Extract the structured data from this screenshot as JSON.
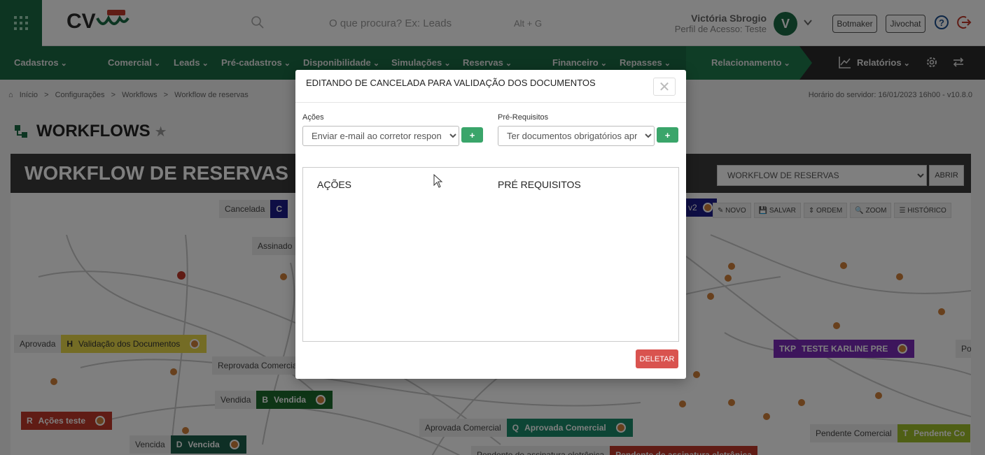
{
  "header": {
    "search_placeholder": "O que procura? Ex: Leads",
    "shortcut": "Alt + G",
    "user_name": "Victória Sbrogio",
    "user_profile": "Perfil de Acesso: Teste",
    "avatar_letter": "V",
    "buttons": [
      "Botmaker",
      "Jivochat"
    ],
    "help": "?"
  },
  "nav": {
    "items": [
      "Cadastros",
      "Comercial",
      "Leads",
      "Pré-cadastros",
      "Disponibilidade",
      "Simulações",
      "Reservas",
      "Financeiro",
      "Repasses",
      "Relacionamento",
      "Relatórios"
    ]
  },
  "breadcrumb": {
    "items": [
      "Início",
      ">",
      "Configurações",
      ">",
      "Workflows",
      ">",
      "Workflow de reservas"
    ]
  },
  "server_time": "Horário do servidor: 16/01/2023 16h00 - v10.8.0",
  "page": {
    "title": "WORKFLOWS",
    "star": "★"
  },
  "workflow": {
    "title": "WORKFLOW DE RESERVAS",
    "select_value": "WORKFLOW DE RESERVAS",
    "open_button": "ABRIR",
    "toolbar": [
      "NOVO",
      "SALVAR",
      "ORDEM",
      "ZOOM",
      "HISTÓRICO"
    ],
    "nodes": [
      {
        "label": "Cancelada",
        "code": "C",
        "name": ""
      },
      {
        "label": "Assinado",
        "code": "",
        "name": ""
      },
      {
        "label": "Aprovada",
        "code": "H",
        "name": "Validação dos Documentos"
      },
      {
        "label": "Reprovada Comercial",
        "code": "",
        "name": ""
      },
      {
        "label": "Vendida",
        "code": "B",
        "name": "Vendida"
      },
      {
        "label": "",
        "code": "R",
        "name": "Ações teste"
      },
      {
        "label": "Vencida",
        "code": "D",
        "name": "Vencida"
      },
      {
        "label": "Aprovada Comercial",
        "code": "Q",
        "name": "Aprovada Comercial"
      },
      {
        "label": "",
        "code": "TKP",
        "name": "TESTE KARLINE PRE"
      },
      {
        "label": "Pendente Comercial",
        "code": "T",
        "name": "Pendente Co"
      },
      {
        "label": "Pendente de assinatura eletrônica",
        "code": "",
        "name": "Pendente de assinatura eletrônica"
      },
      {
        "label": "Po",
        "code": "",
        "name": ""
      },
      {
        "label": "",
        "code": "",
        "name": "v2"
      }
    ]
  },
  "modal": {
    "title": "EDITANDO DE CANCELADA PARA VALIDAÇÃO DOS DOCUMENTOS",
    "close": "✕",
    "actions_label": "Ações",
    "actions_value": "Enviar e-mail ao corretor responsável",
    "prereq_label": "Pré-Requisitos",
    "prereq_value": "Ter documentos obrigatórios aprovados",
    "add": "+",
    "col_actions": "AÇÕES",
    "col_prereq": "PRÉ REQUISITOS",
    "delete": "DELETAR"
  },
  "colors": {
    "brand_green": "#1a6b44",
    "delete_red": "#d9534f",
    "add_green": "#3aa56a"
  }
}
